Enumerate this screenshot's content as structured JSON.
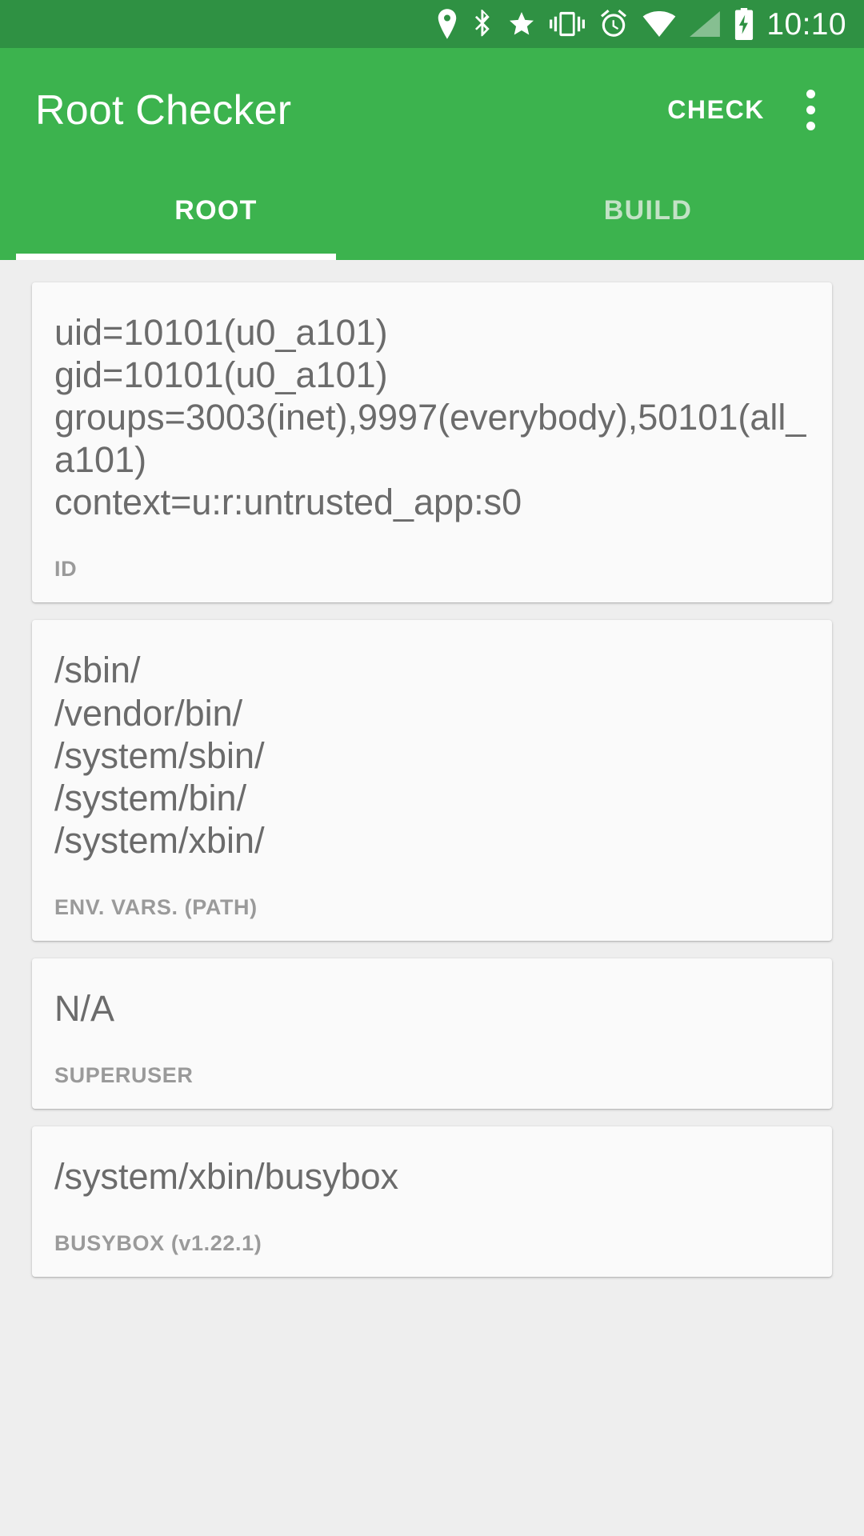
{
  "status_bar": {
    "time": "10:10",
    "icons": [
      "location-icon",
      "bluetooth-icon",
      "star-icon",
      "vibrate-icon",
      "alarm-icon",
      "wifi-icon",
      "signal-icon",
      "battery-charging-icon"
    ]
  },
  "app_bar": {
    "title": "Root Checker",
    "check_label": "CHECK",
    "overflow_label": "More options"
  },
  "tabs": [
    {
      "label": "ROOT",
      "active": true
    },
    {
      "label": "BUILD",
      "active": false
    }
  ],
  "cards": [
    {
      "value": "uid=10101(u0_a101)\ngid=10101(u0_a101)\ngroups=3003(inet),9997(everybody),50101(all_a101)\ncontext=u:r:untrusted_app:s0",
      "label": "ID"
    },
    {
      "value": "/sbin/\n/vendor/bin/\n/system/sbin/\n/system/bin/\n/system/xbin/",
      "label": "ENV. VARS. (PATH)"
    },
    {
      "value": "N/A",
      "label": "SUPERUSER"
    },
    {
      "value": "/system/xbin/busybox",
      "label": "BUSYBOX (v1.22.1)"
    }
  ],
  "colors": {
    "status_bar": "#2f9143",
    "app_bar": "#3cb34e",
    "background": "#eeeeee",
    "card": "#fafafa",
    "value_text": "#6b6b6b",
    "label_text": "#9a9a9a",
    "tab_active": "#ffffff",
    "tab_inactive": "#c3e2c6"
  }
}
